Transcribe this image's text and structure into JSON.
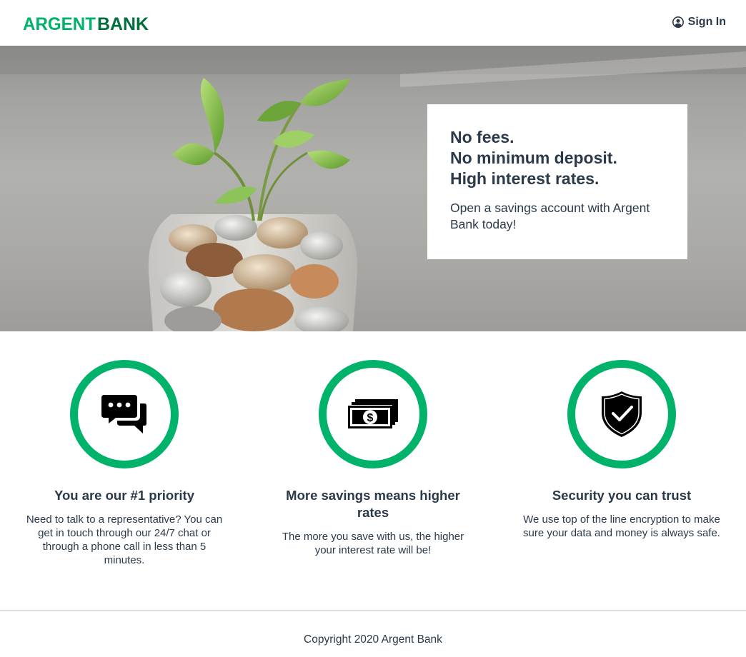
{
  "brand": {
    "name_part1": "ARGENT",
    "name_part2": "BANK",
    "color_primary": "#00b26a",
    "color_dark": "#006f3c"
  },
  "nav": {
    "sign_in_label": "Sign In",
    "sign_in_icon": "user-circle-icon"
  },
  "hero": {
    "headline": [
      "No fees.",
      "No minimum deposit.",
      "High interest rates."
    ],
    "subtext": "Open a savings account with Argent Bank today!",
    "image": "plant-in-jar-of-coins"
  },
  "features": [
    {
      "icon": "chat-bubbles-icon",
      "title": "You are our #1 priority",
      "text": "Need to talk to a representative? You can get in touch through our 24/7 chat or through a phone call in less than 5 minutes."
    },
    {
      "icon": "money-stack-icon",
      "title": "More savings means higher rates",
      "text": "The more you save with us, the higher your interest rate will be!"
    },
    {
      "icon": "shield-check-icon",
      "title": "Security you can trust",
      "text": "We use top of the line encryption to make sure your data and money is always safe."
    }
  ],
  "footer": {
    "copyright": "Copyright 2020 Argent Bank"
  }
}
